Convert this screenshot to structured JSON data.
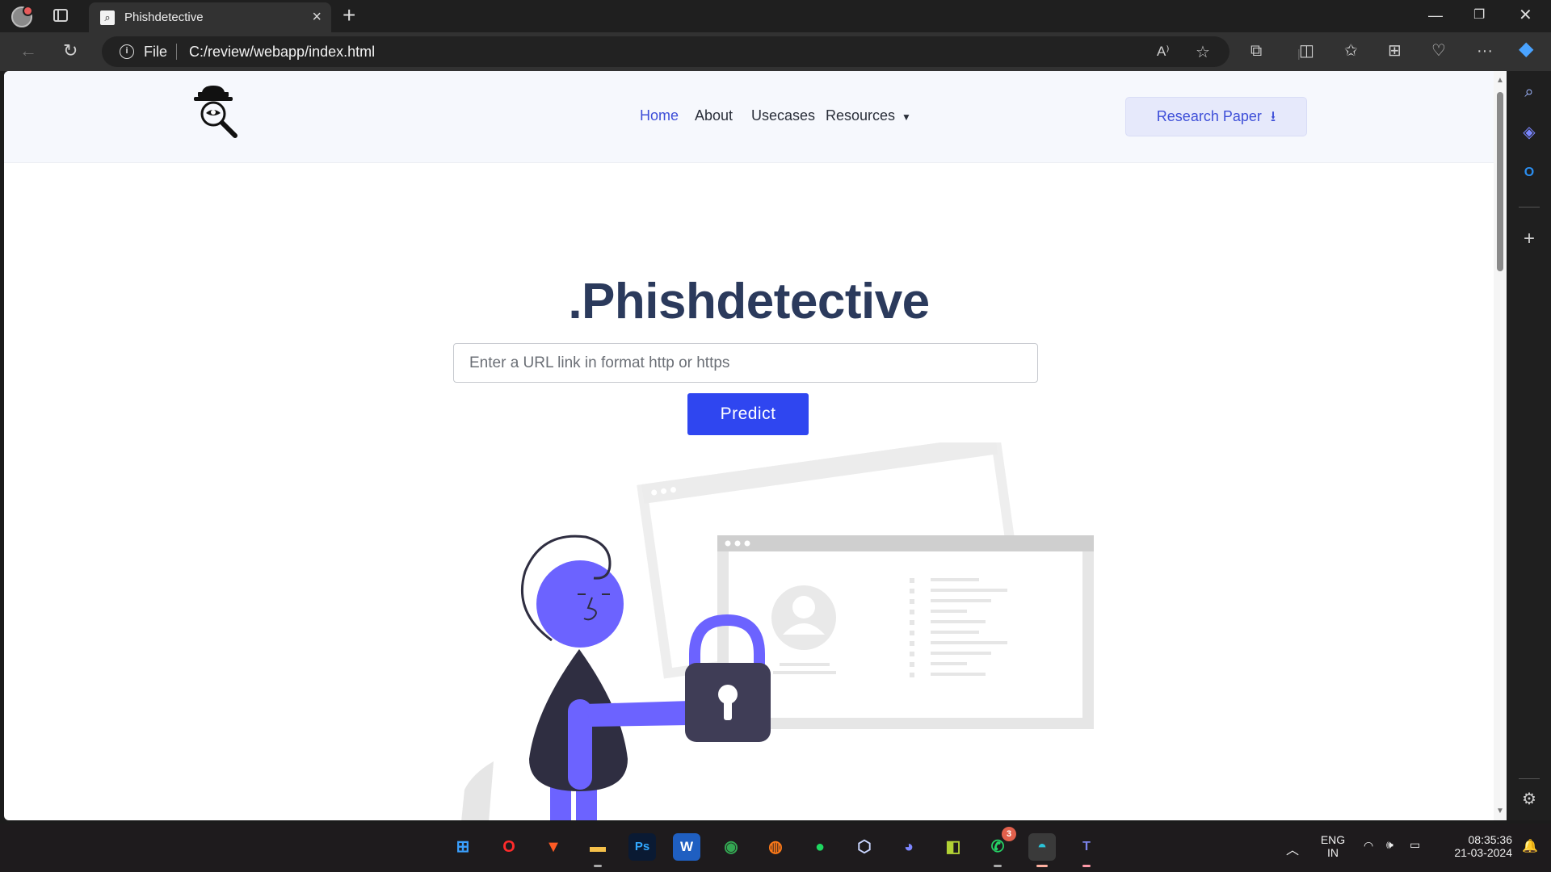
{
  "browser": {
    "tab_title": "Phishdetective",
    "address_label": "File",
    "url": "C:/review/webapp/index.html"
  },
  "site": {
    "nav": {
      "links": [
        "Home",
        "About",
        "Usecases",
        "Resources"
      ],
      "active": "Home",
      "research_button": "Research Paper"
    },
    "hero": {
      "title": ".Phishdetective",
      "input_placeholder": "Enter a URL link in format http or https",
      "input_value": "",
      "predict_label": "Predict"
    }
  },
  "colors": {
    "accent": "#2f46f0",
    "title": "#2b3a5c",
    "illustration_purple": "#6c63ff",
    "illustration_dark": "#3f3d56"
  },
  "taskbar": {
    "apps": [
      "start-icon",
      "opera-icon",
      "brave-icon",
      "file-explorer-icon",
      "photoshop-icon",
      "word-icon",
      "chrome-icon",
      "firefox-icon",
      "spotify-icon",
      "virtualbox-icon",
      "discord-icon",
      "pycharm-icon",
      "whatsapp-icon",
      "edge-icon",
      "teams-icon"
    ],
    "whatsapp_badge": "3",
    "lang_line1": "ENG",
    "lang_line2": "IN",
    "time": "08:35:36",
    "date": "21-03-2024"
  }
}
